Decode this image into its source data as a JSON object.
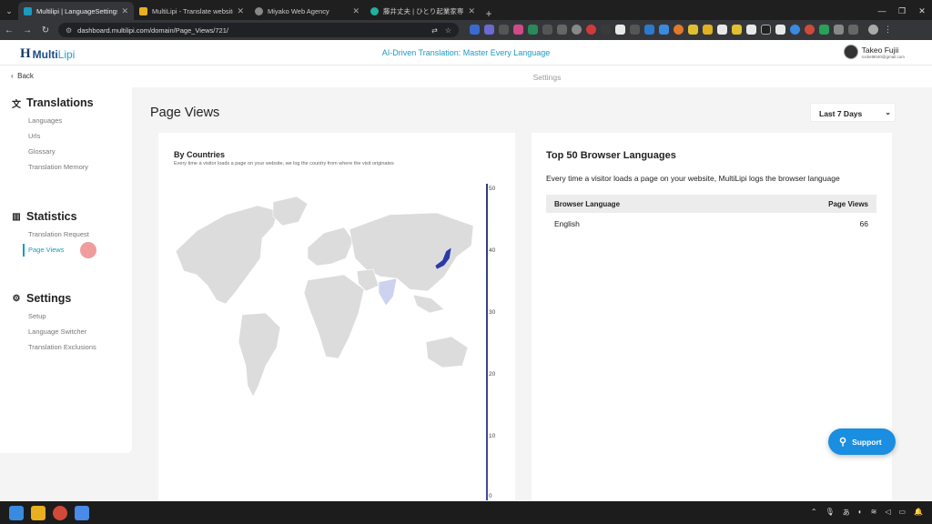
{
  "browser": {
    "tabs": [
      {
        "title": "Multilipi | LanguageSettings",
        "color": "#1a9ac0"
      },
      {
        "title": "MultiLipi - Translate websites in",
        "color": "#e8b020"
      },
      {
        "title": "Miyako Web Agency",
        "color": "#888888"
      },
      {
        "title": "藤井丈夫 | ひとり起業家専門のWe",
        "color": "#20b0a0"
      }
    ],
    "url": "dashboard.multilipi.com/domain/Page_Views/721/"
  },
  "header": {
    "logo_mark": "H",
    "logo_multi": "Multi",
    "logo_lipi": "Lipi",
    "tagline": "AI-Driven Translation: Master Every Language",
    "user_name": "Takeo Fujii",
    "user_email": "rocket8040@gmail.com"
  },
  "subheader": {
    "back_label": "Back",
    "title": "Settings"
  },
  "sidebar": {
    "translations": {
      "title": "Translations",
      "items": [
        "Languages",
        "Urls",
        "Glossary",
        "Translation Memory"
      ]
    },
    "statistics": {
      "title": "Statistics",
      "items": [
        "Translation Request",
        "Page Views"
      ]
    },
    "settings": {
      "title": "Settings",
      "items": [
        "Setup",
        "Language Switcher",
        "Translation Exclusions"
      ]
    },
    "active_item": "Page Views"
  },
  "page": {
    "title": "Page Views",
    "date_range": "Last 7 Days"
  },
  "map_card": {
    "title": "By Countries",
    "subtitle": "Every time a visitor loads a page on your website, we log the country from where the visit originates",
    "scale_ticks": [
      "50",
      "40",
      "30",
      "20",
      "10",
      "0"
    ]
  },
  "lang_card": {
    "title": "Top 50 Browser Languages",
    "subtitle": "Every time a visitor loads a page on your website, MultiLipi logs the browser language",
    "col_language": "Browser Language",
    "col_views": "Page Views",
    "rows": [
      {
        "language": "English",
        "views": "66"
      }
    ]
  },
  "support_label": "Support",
  "colors": {
    "accent": "#1a9ac0",
    "brand": "#1a4a8a",
    "support": "#1a8ee0",
    "highlight_country": "#2a3aa8"
  }
}
